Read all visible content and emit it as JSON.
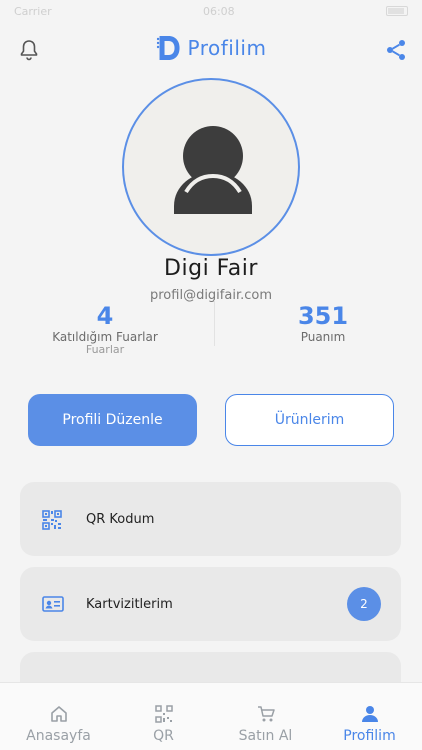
{
  "status": {
    "carrier": "Carrier",
    "time": "06:08"
  },
  "header": {
    "title": "Profilim",
    "brand_letter": "D"
  },
  "profile": {
    "name": "Digi Fair",
    "email": "profil@digifair.com"
  },
  "stats": [
    {
      "value": "4",
      "label": "Katıldığım Fuarlar",
      "label2": "Fuarlar"
    },
    {
      "value": "351",
      "label": "Puanım"
    }
  ],
  "buttons": {
    "edit_label": "Profili Düzenle",
    "products_label": "Ürünlerim"
  },
  "menu": [
    {
      "label": "QR Kodum",
      "icon": "qr-code-icon"
    },
    {
      "label": "Kartvizitlerim",
      "icon": "id-card-icon",
      "badge": "2"
    },
    {
      "label": "",
      "icon": ""
    }
  ],
  "tabs": [
    {
      "label": "Anasayfa",
      "icon": "home-icon"
    },
    {
      "label": "QR",
      "icon": "qr-code-icon"
    },
    {
      "label": "Satın Al",
      "icon": "cart-icon"
    },
    {
      "label": "Profilim",
      "icon": "person-icon",
      "active": true
    }
  ],
  "colors": {
    "accent": "#4a86e8",
    "primary_button": "#5b8fe6",
    "background": "#f4f4f4",
    "card": "#e9e9e9"
  }
}
